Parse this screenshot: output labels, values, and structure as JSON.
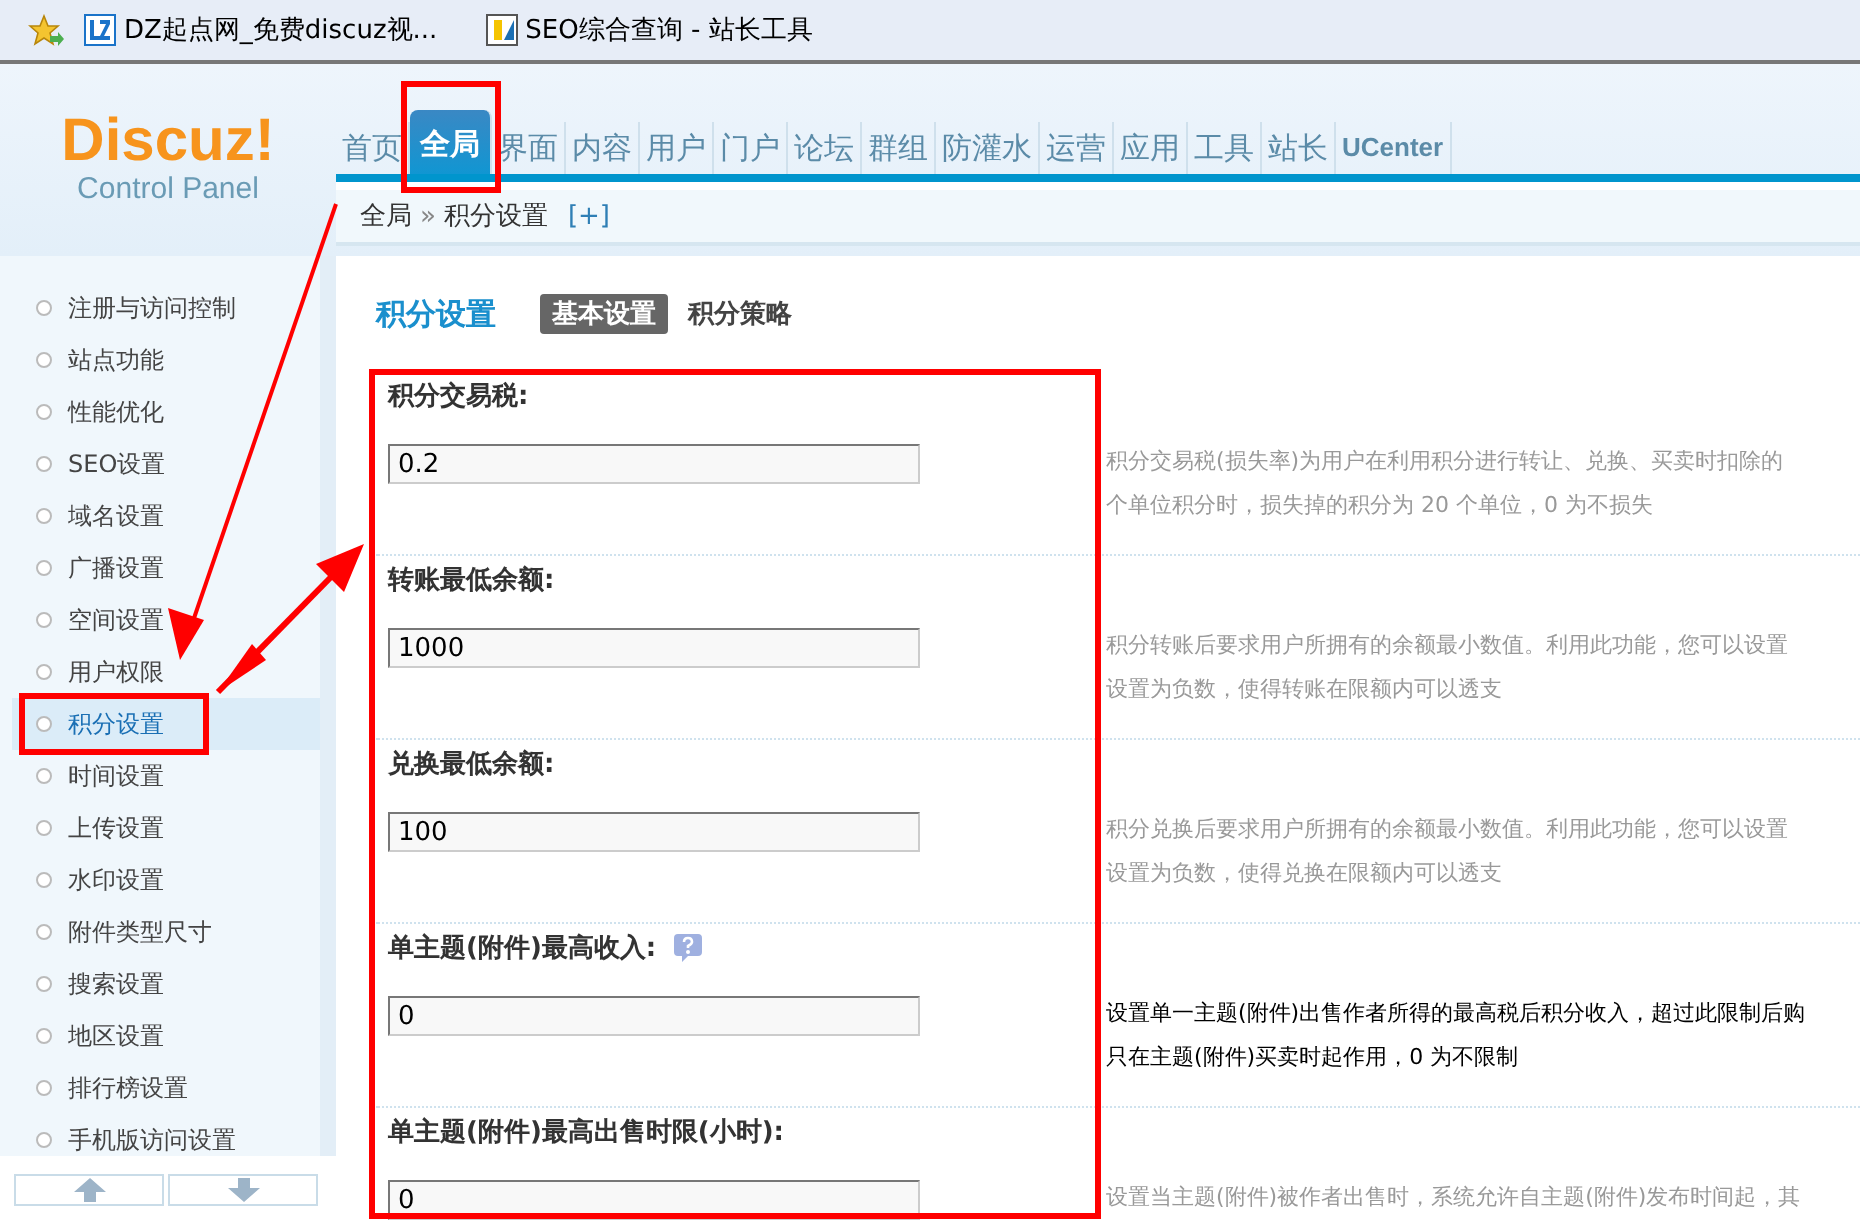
{
  "bookmarks": [
    {
      "kind": "star"
    },
    {
      "kind": "site",
      "label": "DZ起点网_免费discuz视..."
    },
    {
      "kind": "site",
      "label": "SEO综合查询 - 站长工具"
    }
  ],
  "logo": {
    "title": "Discuz!",
    "subtitle": "Control Panel"
  },
  "nav": [
    {
      "label": "首页",
      "selected": false
    },
    {
      "label": "全局",
      "selected": true
    },
    {
      "label": "界面",
      "selected": false
    },
    {
      "label": "内容",
      "selected": false
    },
    {
      "label": "用户",
      "selected": false
    },
    {
      "label": "门户",
      "selected": false
    },
    {
      "label": "论坛",
      "selected": false
    },
    {
      "label": "群组",
      "selected": false
    },
    {
      "label": "防灌水",
      "selected": false
    },
    {
      "label": "运营",
      "selected": false
    },
    {
      "label": "应用",
      "selected": false
    },
    {
      "label": "工具",
      "selected": false
    },
    {
      "label": "站长",
      "selected": false
    },
    {
      "label": "UCenter",
      "selected": false
    }
  ],
  "breadcrumb": {
    "parts": [
      "全局",
      "积分设置"
    ],
    "separator": "»",
    "add": "[+]"
  },
  "sidebar": {
    "items": [
      {
        "label": "注册与访问控制",
        "selected": false
      },
      {
        "label": "站点功能",
        "selected": false
      },
      {
        "label": "性能优化",
        "selected": false
      },
      {
        "label": "SEO设置",
        "selected": false
      },
      {
        "label": "域名设置",
        "selected": false
      },
      {
        "label": "广播设置",
        "selected": false
      },
      {
        "label": "空间设置",
        "selected": false
      },
      {
        "label": "用户权限",
        "selected": false
      },
      {
        "label": "积分设置",
        "selected": true
      },
      {
        "label": "时间设置",
        "selected": false
      },
      {
        "label": "上传设置",
        "selected": false
      },
      {
        "label": "水印设置",
        "selected": false
      },
      {
        "label": "附件类型尺寸",
        "selected": false
      },
      {
        "label": "搜索设置",
        "selected": false
      },
      {
        "label": "地区设置",
        "selected": false
      },
      {
        "label": "排行榜设置",
        "selected": false
      },
      {
        "label": "手机版访问设置",
        "selected": false
      }
    ]
  },
  "page": {
    "title": "积分设置",
    "subtabs": [
      {
        "label": "基本设置",
        "selected": true
      },
      {
        "label": "积分策略",
        "selected": false
      }
    ]
  },
  "form": {
    "rows": [
      {
        "label": "积分交易税:",
        "value": "0.2",
        "highlighted": false,
        "description": [
          "积分交易税(损失率)为用户在利用积分进行转让、兑换、买卖时扣除的",
          "个单位积分时，损失掉的积分为 20 个单位，0 为不损失"
        ]
      },
      {
        "label": "转账最低余额:",
        "value": "1000",
        "highlighted": false,
        "description": [
          "积分转账后要求用户所拥有的余额最小数值。利用此功能，您可以设置",
          "设置为负数，使得转账在限额内可以透支"
        ]
      },
      {
        "label": "兑换最低余额:",
        "value": "100",
        "highlighted": false,
        "description": [
          "积分兑换后要求用户所拥有的余额最小数值。利用此功能，您可以设置",
          "设置为负数，使得兑换在限额内可以透支"
        ]
      },
      {
        "label": "单主题(附件)最高收入:",
        "help": true,
        "value": "0",
        "highlighted": true,
        "description": [
          "设置单一主题(附件)出售作者所得的最高税后积分收入，超过此限制后购",
          "只在主题(附件)买卖时起作用，0 为不限制"
        ]
      },
      {
        "label": "单主题(附件)最高出售时限(小时):",
        "value": "0",
        "highlighted": false,
        "description": [
          "设置当主题(附件)被作者出售时，系统允许自主题(附件)发布时间起，其"
        ]
      }
    ]
  },
  "annotations": [
    {
      "kind": "tab-box"
    },
    {
      "kind": "item-box"
    },
    {
      "kind": "form-box"
    },
    {
      "kind": "arrow"
    },
    {
      "kind": "double-arrow"
    }
  ]
}
